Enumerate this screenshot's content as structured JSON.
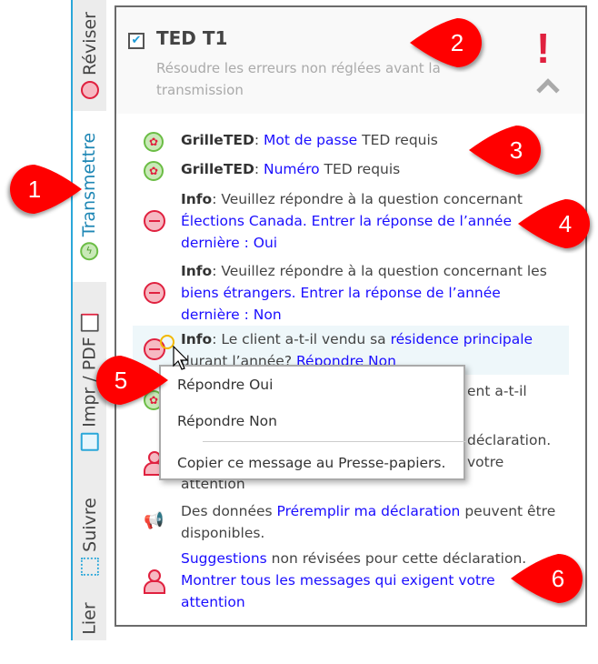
{
  "sidebar": {
    "tabs": [
      {
        "label": "Réviser",
        "icon": "minus-circle-icon",
        "active": false
      },
      {
        "label": "Transmettre",
        "icon": "lightning-icon",
        "active": true
      },
      {
        "label": "Impr / PDF",
        "icon": "printer-pdf-icon",
        "active": false
      },
      {
        "label": "Suivre",
        "icon": "flowchart-icon",
        "active": false
      },
      {
        "label": "Lier",
        "active": false
      }
    ]
  },
  "panel": {
    "checked": true,
    "title": "TED T1",
    "subtitle": "Résoudre les erreurs non réglées avant la transmission",
    "alert": "!",
    "messages": [
      {
        "icon": "maple-leaf-icon",
        "bold": "GrilleTED",
        "sep": ": ",
        "link": "Mot de passe",
        "rest": " TED requis"
      },
      {
        "icon": "maple-leaf-icon",
        "bold": "GrilleTED",
        "sep": ": ",
        "link": "Numéro",
        "rest": " TED requis"
      },
      {
        "icon": "minus-circle-icon",
        "bold": "Info",
        "text": ": Veuillez répondre à la question concernant ",
        "link": "Élections Canada. Entrer la réponse de l’année dernière : Oui"
      },
      {
        "icon": "minus-circle-icon",
        "bold": "Info",
        "text": ": Veuillez répondre à la question concernant les ",
        "link": "biens étrangers. Entrer la réponse de l’année dernière : Non"
      },
      {
        "icon": "minus-circle-icon",
        "bold": "Info",
        "text": ": Le client a-t-il vendu sa ",
        "link": "résidence principale",
        "text2": " durant l’année? ",
        "link2": "Répondre Non"
      },
      {
        "icon": "maple-leaf-icon",
        "partial": "ent a-t-il"
      },
      {
        "icon": "person-icon",
        "partial1": "déclaration.",
        "partial2": "votre",
        "partial3": "attention"
      },
      {
        "icon": "megaphone-icon",
        "text": "Des données ",
        "link": "Préremplir ma déclaration",
        "rest": " peuvent être disponibles."
      },
      {
        "icon": "person-icon",
        "link": "Suggestions",
        "text": " non révisées pour cette déclaration. ",
        "link2": "Montrer tous les messages qui exigent votre attention"
      }
    ]
  },
  "context_menu": {
    "items": [
      "Répondre Oui",
      "Répondre Non",
      "Copier ce message au Presse-papiers."
    ]
  },
  "callouts": [
    "1",
    "2",
    "3",
    "4",
    "5",
    "6"
  ],
  "colors": {
    "accent": "#1f87b5",
    "link": "#1a0dff",
    "error": "#e0213f",
    "callout": "#ff0000",
    "ok": "#6bbd45"
  }
}
